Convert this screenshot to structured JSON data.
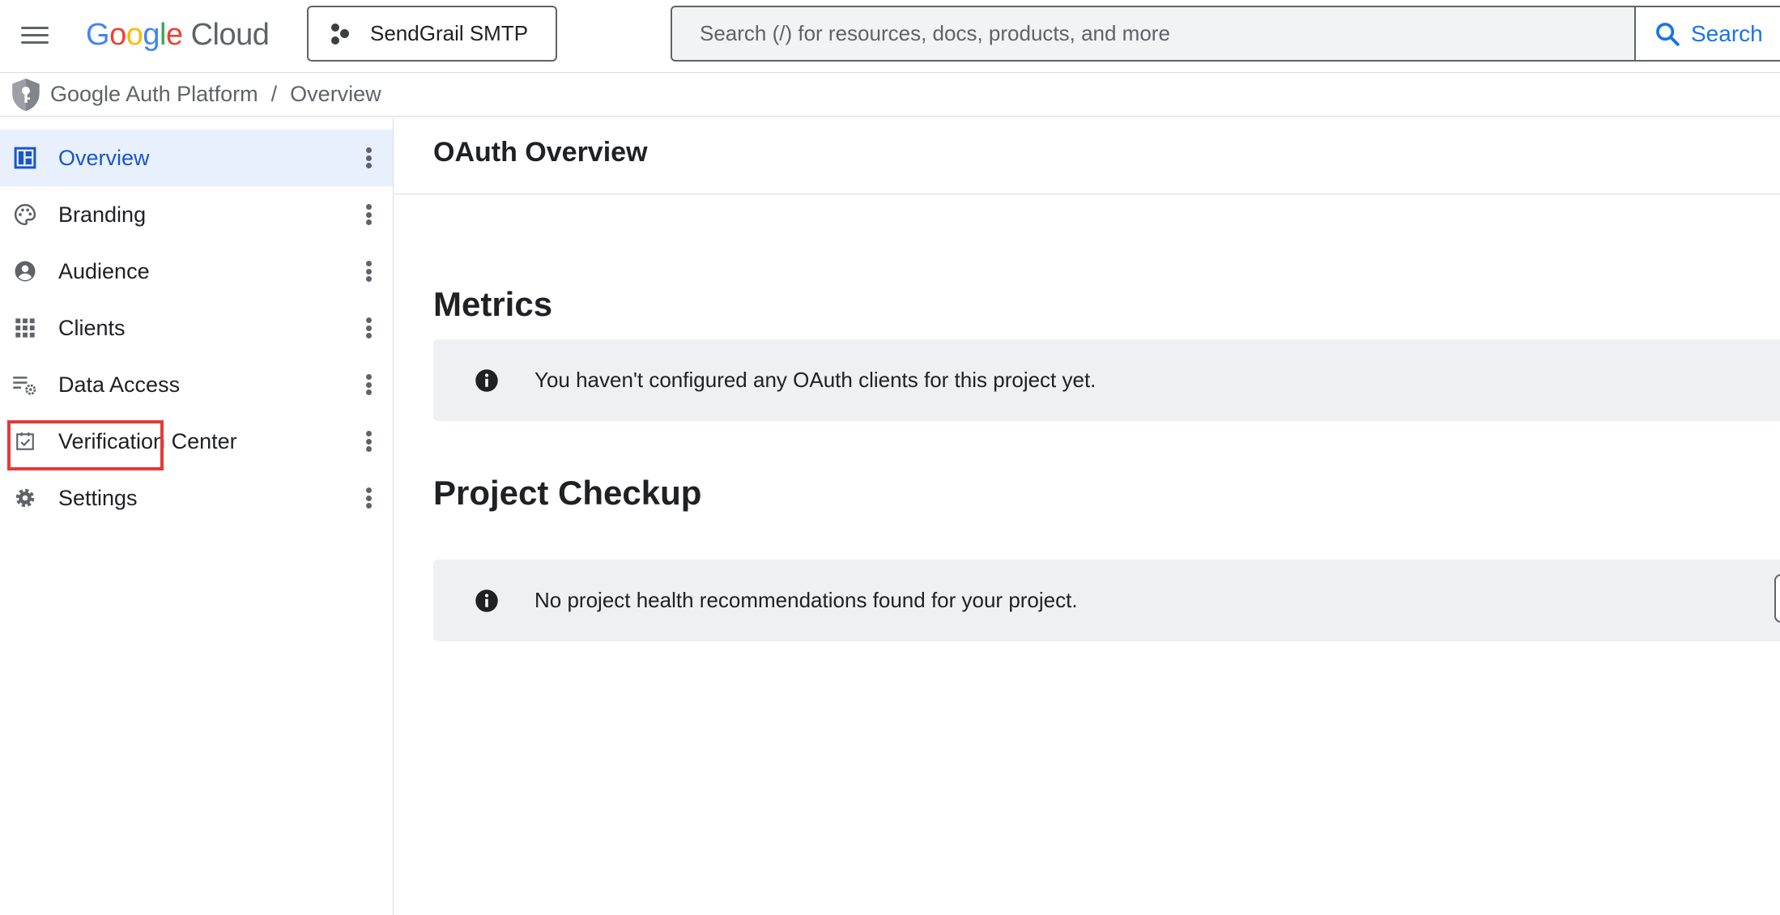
{
  "header": {
    "logo": {
      "letters": [
        "G",
        "o",
        "o",
        "g",
        "l",
        "e"
      ],
      "product": "Cloud"
    },
    "project_selector": {
      "label": "SendGrail SMTP"
    },
    "search": {
      "placeholder": "Search (/) for resources, docs, products, and more",
      "button_label": "Search"
    }
  },
  "breadcrumb": {
    "items": [
      "Google Auth Platform",
      "Overview"
    ],
    "separator": "/"
  },
  "sidebar": {
    "items": [
      {
        "label": "Overview",
        "icon": "dashboard-icon",
        "active": true
      },
      {
        "label": "Branding",
        "icon": "palette-icon",
        "active": false
      },
      {
        "label": "Audience",
        "icon": "account-circle-icon",
        "active": false
      },
      {
        "label": "Clients",
        "icon": "apps-grid-icon",
        "active": false,
        "highlighted": true
      },
      {
        "label": "Data Access",
        "icon": "list-settings-icon",
        "active": false
      },
      {
        "label": "Verification Center",
        "icon": "checkbox-icon",
        "active": false
      },
      {
        "label": "Settings",
        "icon": "gear-icon",
        "active": false
      }
    ]
  },
  "main": {
    "title": "OAuth Overview",
    "metrics": {
      "heading": "Metrics",
      "message": "You haven't configured any OAuth clients for this project yet."
    },
    "checkup": {
      "heading": "Project Checkup",
      "message": "No project health recommendations found for your project."
    }
  },
  "colors": {
    "accent": "#1a73e8",
    "active_bg": "#e8f0fe",
    "highlight": "#e53935",
    "info_bg": "#eef0f4"
  }
}
